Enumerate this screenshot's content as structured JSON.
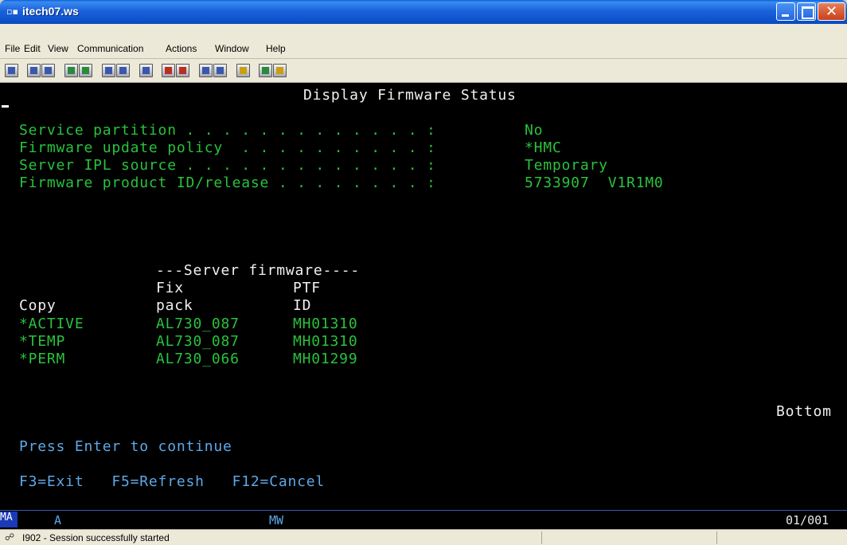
{
  "window": {
    "title": "itech07.ws",
    "icon": "terminal-app-icon"
  },
  "menu": [
    "File",
    "Edit",
    "View",
    "Communication",
    "Actions",
    "Window",
    "Help"
  ],
  "toolbar": {
    "icons": [
      "print-screen-icon",
      "copy-icon",
      "paste-icon",
      "send-icon",
      "receive-icon",
      "display-icon",
      "keypad-icon",
      "macro-icon",
      "record-icon",
      "play-icon",
      "stop-icon",
      "chart-icon",
      "color-icon",
      "map-icon",
      "help-icon"
    ]
  },
  "screen": {
    "title": "Display Firmware Status",
    "fields": [
      {
        "label": "Service partition . . . . . . . . . . . . . :",
        "value": "No"
      },
      {
        "label": "Firmware update policy  . . . . . . . . . . :",
        "value": "*HMC"
      },
      {
        "label": "Server IPL source . . . . . . . . . . . . . :",
        "value": "Temporary"
      },
      {
        "label": "Firmware product ID/release . . . . . . . . :",
        "value": "5733907  V1R1M0"
      }
    ],
    "table": {
      "group_header": "---Server firmware----",
      "header_row1": [
        "",
        "Fix",
        "PTF"
      ],
      "header_row2": [
        "Copy",
        "pack",
        "ID"
      ],
      "rows": [
        [
          "*ACTIVE",
          "AL730_087",
          "MH01310"
        ],
        [
          "*TEMP",
          "AL730_087",
          "MH01310"
        ],
        [
          "*PERM",
          "AL730_066",
          "MH01299"
        ]
      ]
    },
    "more_indicator": "Bottom",
    "instruction": "Press Enter to continue",
    "function_keys": "F3=Exit   F5=Refresh   F12=Cancel"
  },
  "oia": {
    "ma": "MA",
    "mode": "A",
    "mw": "MW",
    "cursor_pos": "01/001"
  },
  "status": {
    "message": "I902 - Session successfully started"
  }
}
